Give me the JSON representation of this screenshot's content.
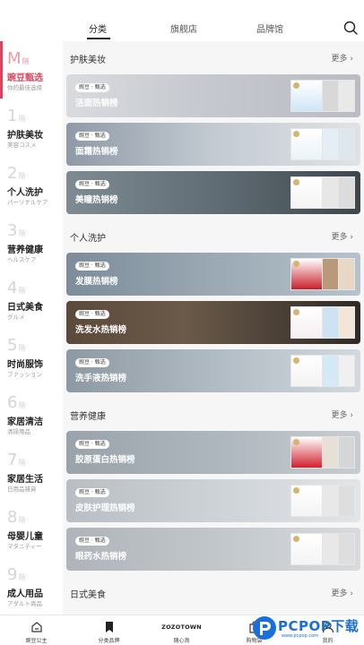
{
  "tabs": [
    "分类",
    "旗舰店",
    "品牌馆"
  ],
  "sidebar": [
    {
      "num": "M",
      "suffix": "階",
      "title": "豌豆甄选",
      "sub": "你的最佳选择"
    },
    {
      "num": "1",
      "suffix": "階",
      "title": "护肤美妆",
      "sub": "美容コスメ"
    },
    {
      "num": "2",
      "suffix": "階",
      "title": "个人洗护",
      "sub": "パーソナルケア"
    },
    {
      "num": "3",
      "suffix": "階",
      "title": "营养健康",
      "sub": "ヘルスケア"
    },
    {
      "num": "4",
      "suffix": "階",
      "title": "日式美食",
      "sub": "グルメ"
    },
    {
      "num": "5",
      "suffix": "階",
      "title": "时尚服饰",
      "sub": "ファッション"
    },
    {
      "num": "6",
      "suffix": "階",
      "title": "家居清洁",
      "sub": "清掃用品"
    },
    {
      "num": "7",
      "suffix": "階",
      "title": "家居生活",
      "sub": "日用品雑貨"
    },
    {
      "num": "8",
      "suffix": "階",
      "title": "母婴儿童",
      "sub": "マタニティー"
    },
    {
      "num": "9",
      "suffix": "階",
      "title": "成人用品",
      "sub": "アダルト商品"
    }
  ],
  "sections": [
    {
      "title": "护肤美妆",
      "more": "更多 ›",
      "cards": [
        {
          "badge": "豌豆 · 甄选",
          "title": "洁面热销榜"
        },
        {
          "badge": "豌豆 · 甄选",
          "title": "面霜热销榜"
        },
        {
          "badge": "豌豆 · 甄选",
          "title": "美瞳热销榜"
        }
      ]
    },
    {
      "title": "个人洗护",
      "more": "更多 ›",
      "cards": [
        {
          "badge": "豌豆 · 甄选",
          "title": "发膜热销榜"
        },
        {
          "badge": "豌豆 · 甄选",
          "title": "洗发水热销榜"
        },
        {
          "badge": "豌豆 · 甄选",
          "title": "洗手液热销榜"
        }
      ]
    },
    {
      "title": "营养健康",
      "more": "更多 ›",
      "cards": [
        {
          "badge": "豌豆 · 甄选",
          "title": "胶原蛋白热销榜"
        },
        {
          "badge": "豌豆 · 甄选",
          "title": "皮肤护理热销榜"
        },
        {
          "badge": "豌豆 · 甄选",
          "title": "眼药水热销榜"
        }
      ]
    },
    {
      "title": "日式美食",
      "more": "更多 ›",
      "cards": []
    }
  ],
  "bottom_nav": [
    "豌豆公主",
    "分类品牌",
    "ZOZOTOWN",
    "购物袋",
    "我的"
  ],
  "bottom_nav_zozo_label": "随心淘",
  "watermark": {
    "brand": "PCPOP下载",
    "sub": "www.pcpop.com"
  },
  "colors": {
    "accent": "#d8455f",
    "rank_badge": "#d4b56c",
    "watermark": "#1a6fd8"
  }
}
